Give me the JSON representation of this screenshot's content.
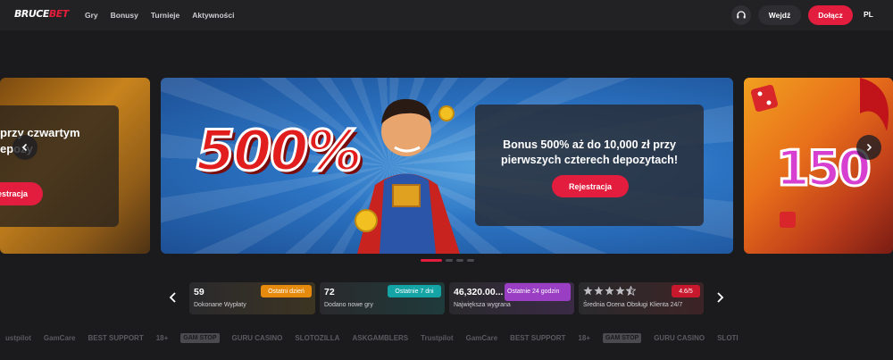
{
  "brand": {
    "logo_part1": "BRUCE",
    "logo_part2": "BET"
  },
  "nav": {
    "items": [
      "Gry",
      "Bonusy",
      "Turnieje",
      "Aktywności"
    ]
  },
  "header": {
    "login_label": "Wejdź",
    "join_label": "Dołącz",
    "language": "PL"
  },
  "carousel": {
    "left_slide": {
      "text_line1": "przy czwartym",
      "text_line2": "epozy",
      "button": "estracja"
    },
    "main_slide": {
      "big_text": "500%",
      "title_line1": "Bonus 500% aż do 10,000 zł przy",
      "title_line2": "pierwszych czterech depozytach!",
      "button": "Rejestracja"
    },
    "right_slide": {
      "big_text": "150"
    }
  },
  "stats": [
    {
      "value": "59",
      "badge": "Ostatni dzień",
      "desc": "Dokonane Wypłaty",
      "badge_color": "#e58a0c"
    },
    {
      "value": "72",
      "badge": "Ostatnie 7 dni",
      "desc": "Dodano nowe gry",
      "badge_color": "#14a4a6"
    },
    {
      "value": "46,320.00...",
      "badge": "Ostatnie 24 godzin",
      "desc": "Największa wygrana",
      "badge_color": "#9a3fc4"
    },
    {
      "rating": "4.6/5",
      "desc": "Średnia Ocena Obsługi Klienta 24/7",
      "badge_color": "#c8182e",
      "stars": 4.5
    }
  ],
  "partners": [
    "ustpilot",
    "GamCare",
    "BEST SUPPORT",
    "18+",
    "GAM STOP",
    "GURU CASINO",
    "SLOTOZILLA",
    "ASKGAMBLERS",
    "Trustpilot",
    "GamCare",
    "BEST SUPPORT",
    "18+",
    "GAM STOP",
    "GURU CASINO",
    "SLOTI"
  ]
}
